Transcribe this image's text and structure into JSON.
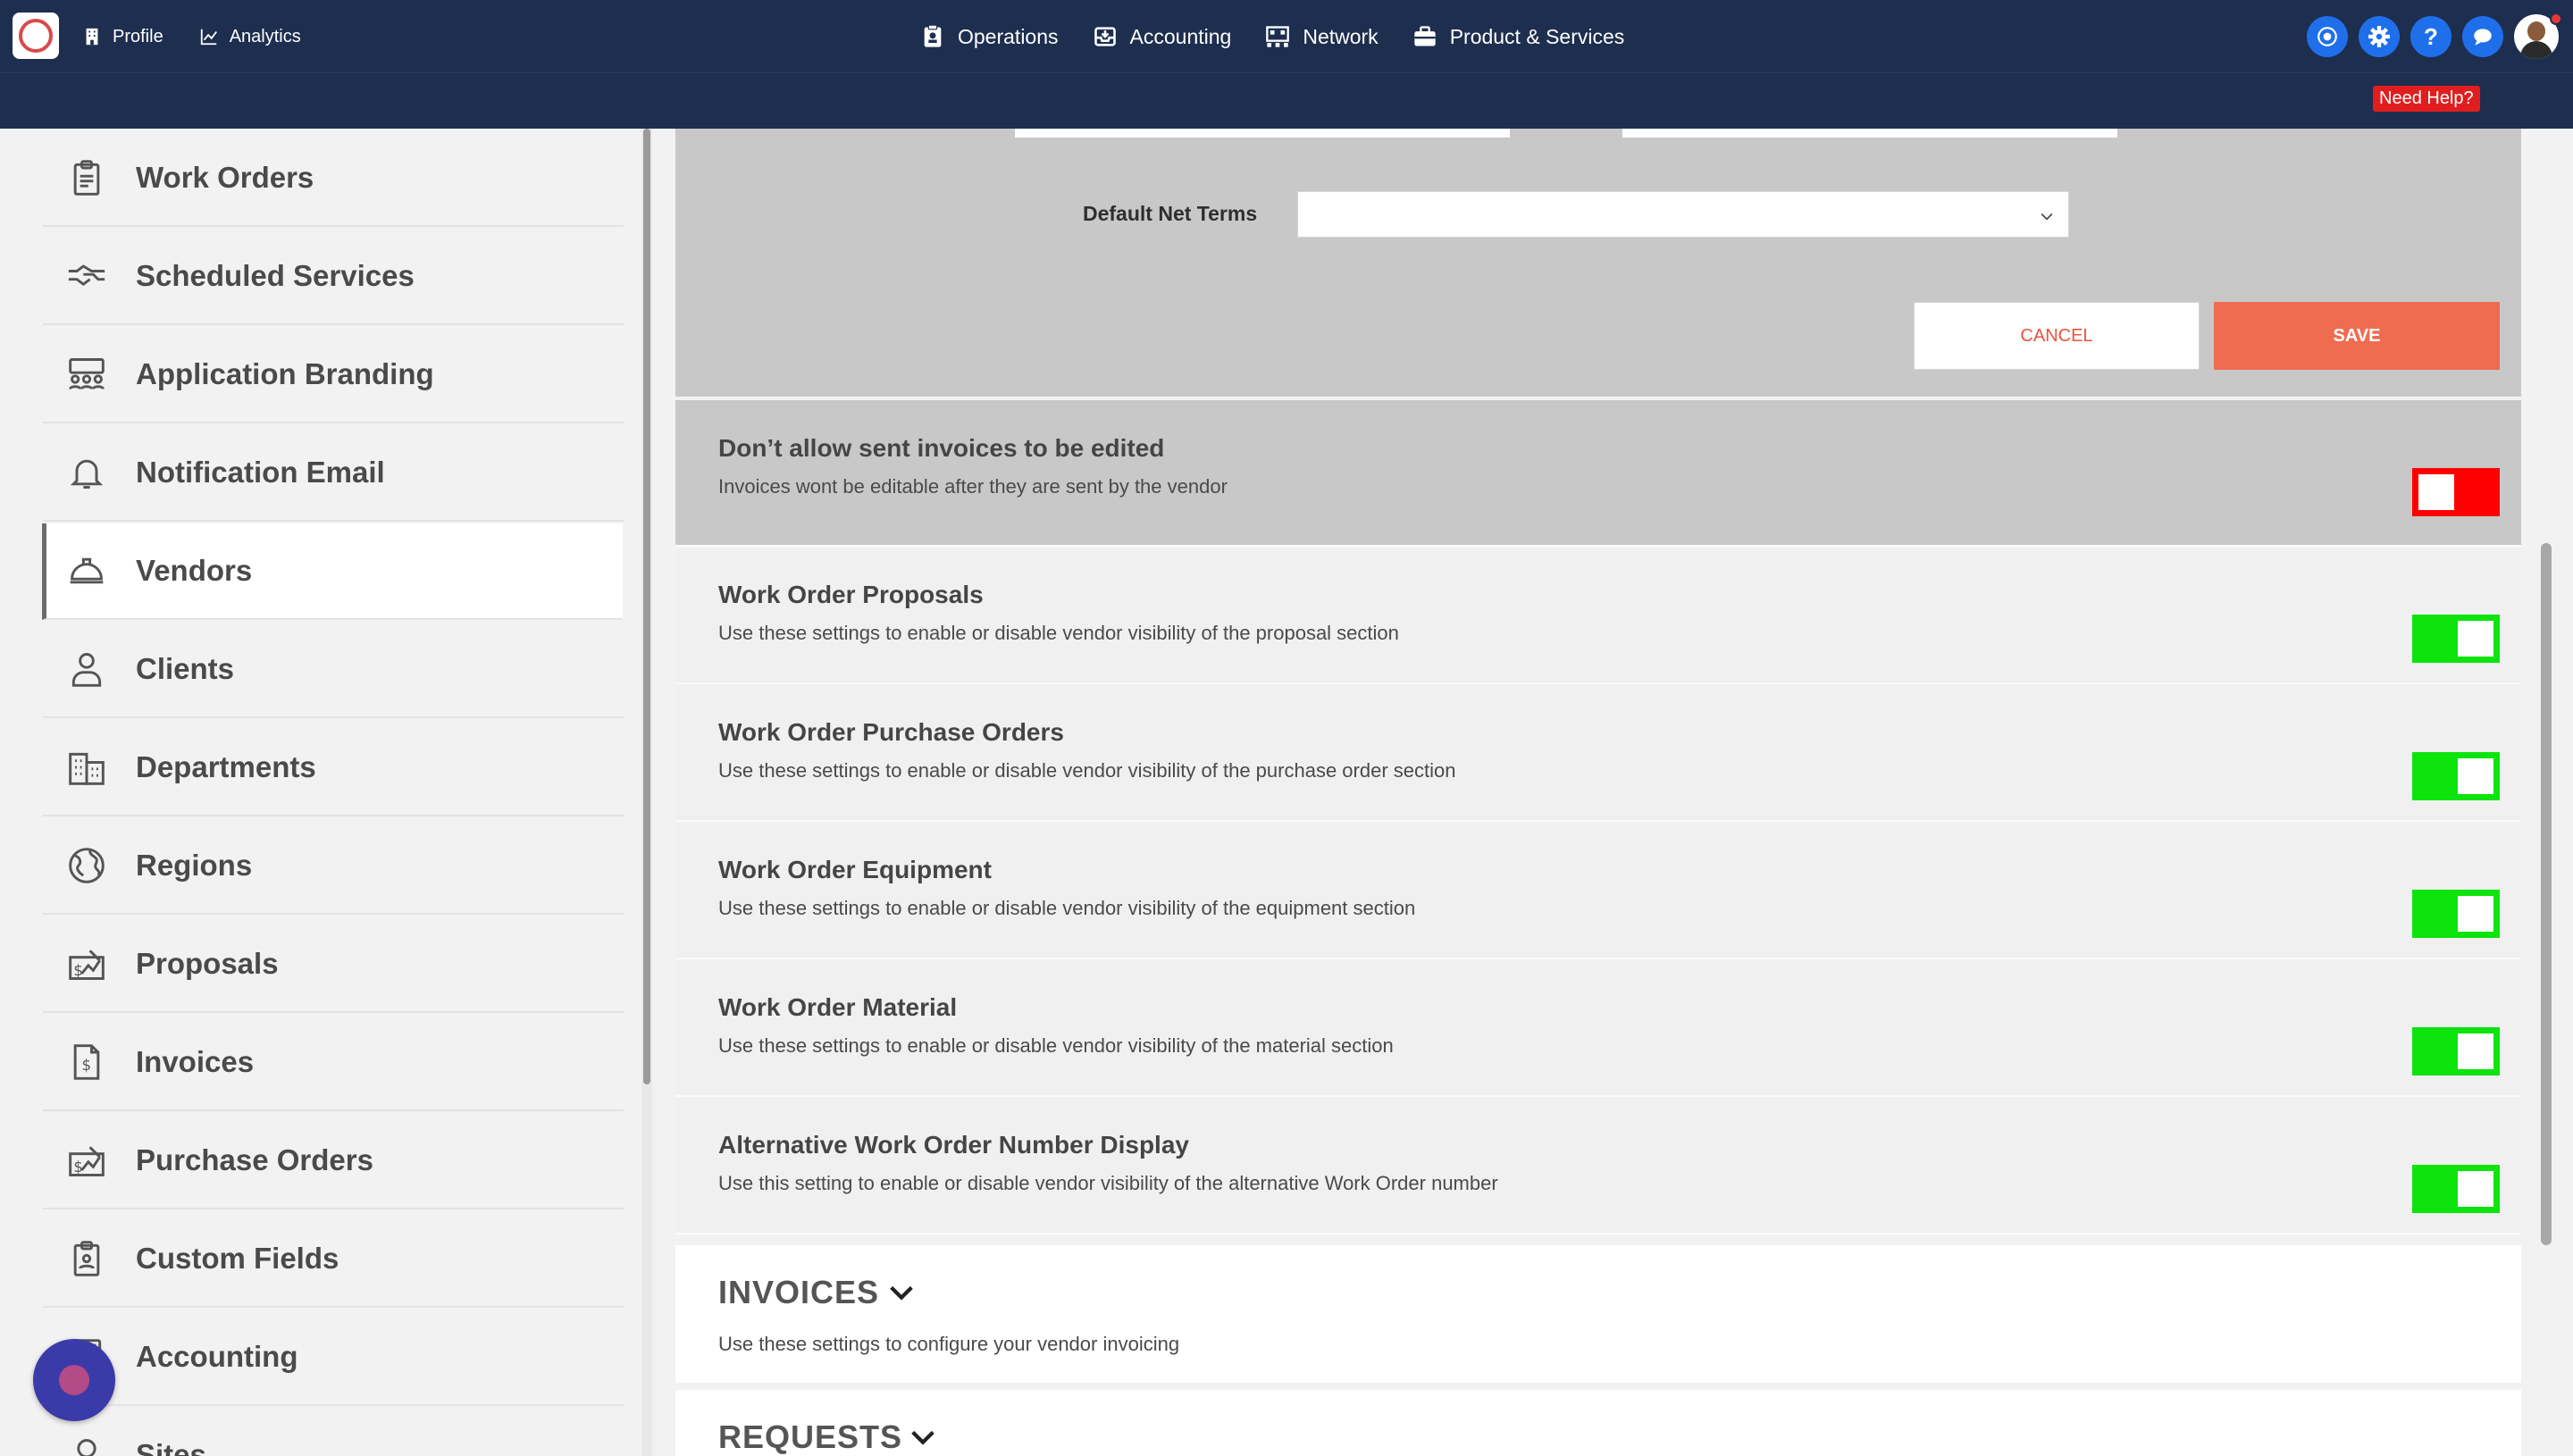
{
  "header": {
    "nav_left": [
      {
        "label": "Profile",
        "icon": "building-icon"
      },
      {
        "label": "Analytics",
        "icon": "chart-line-icon"
      }
    ],
    "nav_center": [
      {
        "label": "Operations",
        "icon": "clipboard-icon"
      },
      {
        "label": "Accounting",
        "icon": "inbox-icon"
      },
      {
        "label": "Network",
        "icon": "network-icon"
      },
      {
        "label": "Product & Services",
        "icon": "briefcase-icon"
      }
    ],
    "right_buttons": [
      "dashboard-icon",
      "gear-icon",
      "help-icon",
      "chat-icon"
    ],
    "help_glyph": "?",
    "need_help": "Need Help?",
    "brand_color": "#1d2e4f",
    "accent_color": "#1f6fea"
  },
  "sidebar": {
    "items": [
      {
        "label": "Work Orders",
        "icon": "clipboard-list-icon"
      },
      {
        "label": "Scheduled Services",
        "icon": "handshake-icon"
      },
      {
        "label": "Application Branding",
        "icon": "people-group-icon"
      },
      {
        "label": "Notification Email",
        "icon": "bell-icon"
      },
      {
        "label": "Vendors",
        "icon": "hard-hat-icon",
        "active": true
      },
      {
        "label": "Clients",
        "icon": "person-icon"
      },
      {
        "label": "Departments",
        "icon": "buildings-icon"
      },
      {
        "label": "Regions",
        "icon": "globe-icon"
      },
      {
        "label": "Proposals",
        "icon": "money-signature-icon"
      },
      {
        "label": "Invoices",
        "icon": "invoice-icon"
      },
      {
        "label": "Purchase Orders",
        "icon": "money-signature-icon"
      },
      {
        "label": "Custom Fields",
        "icon": "clipboard-user-icon"
      },
      {
        "label": "Accounting",
        "icon": "calculator-icon"
      },
      {
        "label": "Sites",
        "icon": "map-pin-icon"
      }
    ]
  },
  "form": {
    "net_terms_label": "Default Net Terms",
    "net_terms_value": "",
    "cancel_label": "CANCEL",
    "save_label": "SAVE",
    "save_color": "#f06c51"
  },
  "settings": [
    {
      "title": "Don’t allow sent invoices to be edited",
      "desc": "Invoices wont be editable after they are sent by the vendor",
      "enabled": false
    },
    {
      "title": "Work Order Proposals",
      "desc": "Use these settings to enable or disable vendor visibility of the proposal section",
      "enabled": true
    },
    {
      "title": "Work Order Purchase Orders",
      "desc": "Use these settings to enable or disable vendor visibility of the purchase order section",
      "enabled": true
    },
    {
      "title": "Work Order Equipment",
      "desc": "Use these settings to enable or disable vendor visibility of the equipment section",
      "enabled": true
    },
    {
      "title": "Work Order Material",
      "desc": "Use these settings to enable or disable vendor visibility of the material section",
      "enabled": true
    },
    {
      "title": "Alternative Work Order Number Display",
      "desc": "Use this setting to enable or disable vendor visibility of the alternative Work Order number",
      "enabled": true
    }
  ],
  "toggle_colors": {
    "on": "#0ce40c",
    "off": "#ff0000"
  },
  "sections": [
    {
      "title": "INVOICES",
      "desc": "Use these settings to configure your vendor invoicing"
    },
    {
      "title": "REQUESTS",
      "desc": ""
    }
  ]
}
